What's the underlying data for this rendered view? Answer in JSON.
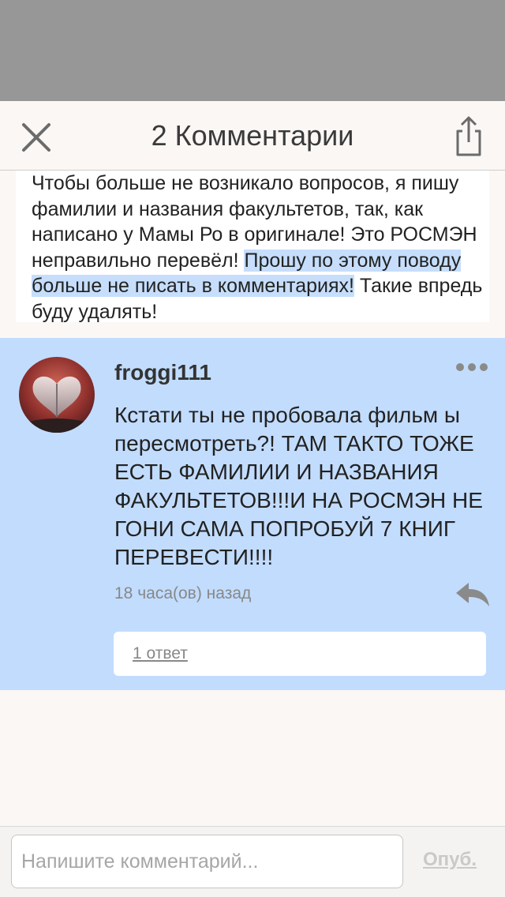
{
  "header": {
    "title": "2 Комментарии"
  },
  "quote": {
    "text_plain": "Чтобы больше не возникало вопросов, я пишу фамилии и названия факультетов, так, как написано у Мамы Ро в оригинале! Это РОСМЭН неправильно перевёл! ",
    "text_highlighted": "Прошу по этому поводу больше не писать в комментариях!",
    "text_after": " Такие впредь буду удалять!"
  },
  "comment": {
    "username": "froggi111",
    "text": "Кстати ты не пробовала фильм ы пересмотреть?! ТАМ ТАКТО ТОЖЕ ЕСТЬ ФАМИЛИИ И НАЗВАНИЯ ФАКУЛЬТЕТОВ!!!И НА РОСМЭН НЕ ГОНИ САМА ПОПРОБУЙ 7 КНИГ ПЕРЕВЕСТИ!!!!",
    "timestamp": "18 часа(ов) назад",
    "replies_label": "1 ответ"
  },
  "composer": {
    "placeholder": "Напишите комментарий...",
    "publish_label": "Опуб."
  },
  "colors": {
    "status_bar": "#979797",
    "comment_bg": "#c2dcfd",
    "highlight": "#c6defc",
    "page_bg": "#faf7f5"
  },
  "icons": [
    "close-icon",
    "share-icon",
    "more-icon",
    "reply-icon"
  ]
}
